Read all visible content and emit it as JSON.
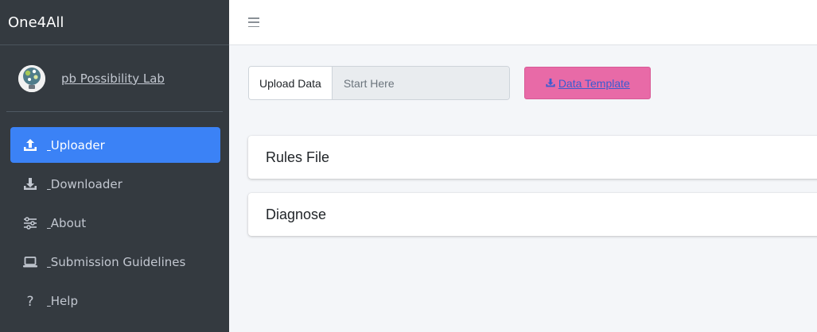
{
  "app": {
    "brand_title": "One4All"
  },
  "user_panel": {
    "name": "pb Possibility Lab",
    "logo_icon": "pb-lab-logo-icon"
  },
  "sidebar": {
    "items": [
      {
        "label": "Uploader",
        "icon": "upload-icon",
        "active": true
      },
      {
        "label": "Downloader",
        "icon": "download-icon",
        "active": false
      },
      {
        "label": "About",
        "icon": "sliders-icon",
        "active": false
      },
      {
        "label": "Submission Guidelines",
        "icon": "laptop-icon",
        "active": false
      },
      {
        "label": "Help",
        "icon": "question-icon",
        "active": false
      }
    ],
    "bg_color": "#343a40",
    "active_color": "#3b82f6"
  },
  "topbar": {
    "menu_icon": "hamburger-menu-icon"
  },
  "upload": {
    "label": "Upload Data",
    "placeholder": "Start Here",
    "template_button": "Data Template",
    "template_color": "#e86aa7"
  },
  "cards": {
    "rules_title": "Rules File",
    "diagnose_title": "Diagnose"
  }
}
